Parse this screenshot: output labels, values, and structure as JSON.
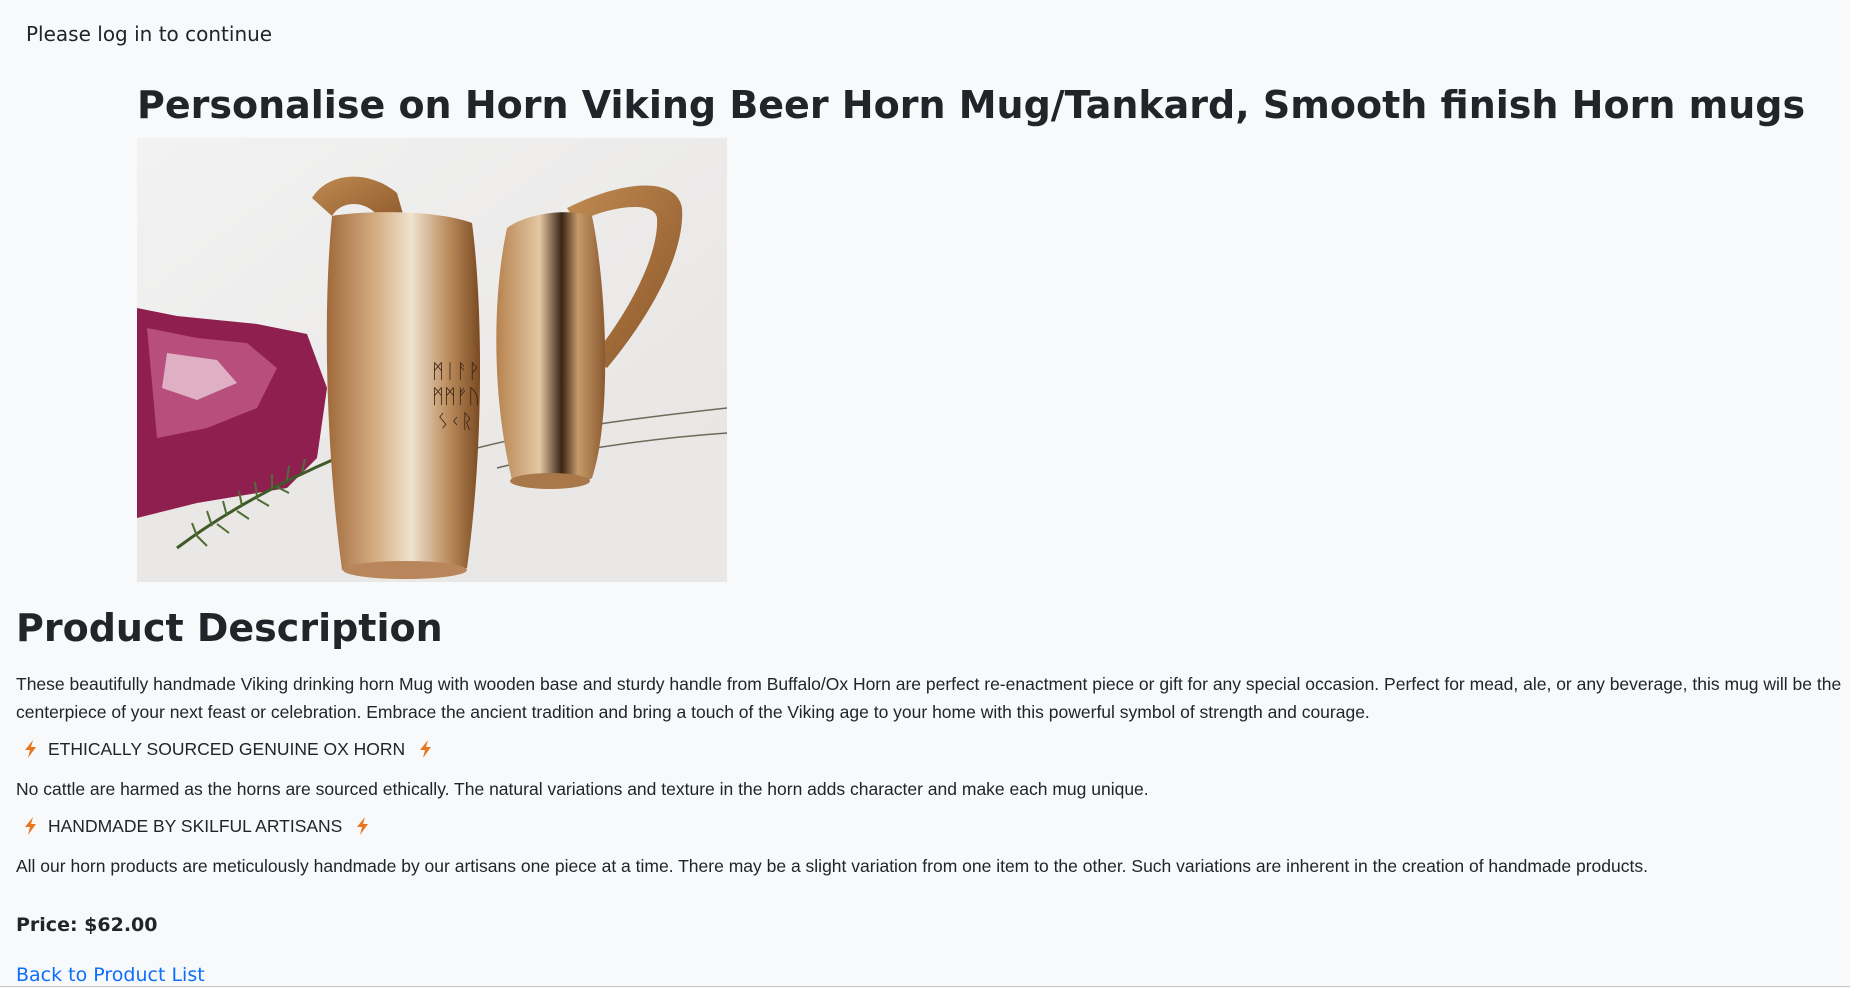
{
  "auth": {
    "login_message": "Please log in to continue"
  },
  "product": {
    "title": "Personalise on Horn Viking Beer Horn Mug/Tankard, Smooth finish Horn mugs",
    "image_alt": "Two horn mugs with wooden bases, one engraved with runes"
  },
  "description": {
    "heading": "Product Description",
    "intro": "These beautifully handmade Viking drinking horn Mug with wooden base and sturdy handle from Buffalo/Ox Horn are perfect re-enactment piece or gift for any special occasion. Perfect for mead, ale, or any beverage, this mug will be the centerpiece of your next feast or celebration. Embrace the ancient tradition and bring a touch of the Viking age to your home with this powerful symbol of strength and courage.",
    "features": [
      {
        "title": "ETHICALLY SOURCED GENUINE OX HORN",
        "text": "No cattle are harmed as the horns are sourced ethically. The natural variations and texture in the horn adds character and make each mug unique."
      },
      {
        "title": "HANDMADE BY SKILFUL ARTISANS",
        "text": "All our horn products are meticulously handmade by our artisans one piece at a time. There may be a slight variation from one item to the other. Such variations are inherent in the creation of handmade products."
      }
    ],
    "feature_icon": "lightning-bolt-icon",
    "feature_icon_color": "#e8761e"
  },
  "pricing": {
    "price_label": "Price: $62.00"
  },
  "navigation": {
    "back_link": "Back to Product List"
  },
  "colors": {
    "background": "#f8f9fa",
    "text": "#212529",
    "link": "#0d6efd"
  }
}
